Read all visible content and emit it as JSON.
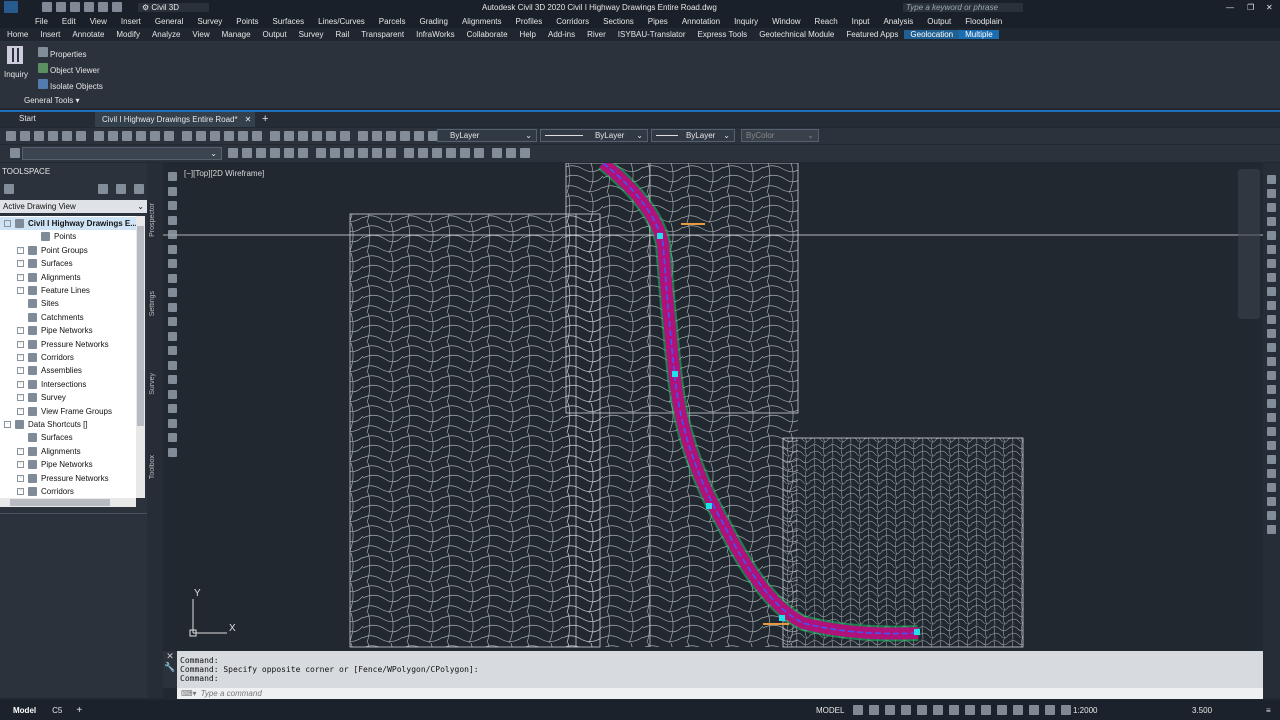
{
  "app": {
    "title": "Autodesk Civil 3D 2020    Civil I Highway Drawings Entire Road.dwg",
    "workspace": "Civil 3D",
    "search_placeholder": "Type a keyword or phrase"
  },
  "menu": [
    "File",
    "Edit",
    "View",
    "Insert",
    "General",
    "Survey",
    "Points",
    "Surfaces",
    "Lines/Curves",
    "Parcels",
    "Grading",
    "Alignments",
    "Profiles",
    "Corridors",
    "Sections",
    "Pipes",
    "Annotation",
    "Inquiry",
    "Window",
    "Reach",
    "Input",
    "Analysis",
    "Output",
    "Floodplain"
  ],
  "ribbon_tabs": [
    "Home",
    "Insert",
    "Annotate",
    "Modify",
    "Analyze",
    "View",
    "Manage",
    "Output",
    "Survey",
    "Rail",
    "Transparent",
    "InfraWorks",
    "Collaborate",
    "Help",
    "Add-ins",
    "River",
    "ISYBAU-Translator",
    "Express Tools",
    "Geotechnical Module",
    "Featured Apps",
    "Geolocation",
    "Multiple"
  ],
  "ribbon": {
    "big_button": "Inquiry",
    "items": [
      "Properties",
      "Object Viewer",
      "Isolate Objects"
    ],
    "panel": "General Tools"
  },
  "doc_tabs": {
    "start": "Start",
    "active": "Civil I Highway Drawings Entire Road*"
  },
  "toolbar": {
    "layer": "ByLayer",
    "linetype": "ByLayer",
    "lineweight": "ByLayer",
    "color": "ByColor"
  },
  "toolspace": {
    "title": "TOOLSPACE",
    "view": "Active Drawing View",
    "tabs": [
      "Prospector",
      "Settings",
      "Survey",
      "Toolbox"
    ],
    "tree": [
      {
        "label": "Civil I Highway Drawings E...",
        "level": 0,
        "exp": "-",
        "bold": true
      },
      {
        "label": "Points",
        "level": 2,
        "exp": ""
      },
      {
        "label": "Point Groups",
        "level": 1,
        "exp": "+"
      },
      {
        "label": "Surfaces",
        "level": 1,
        "exp": "+"
      },
      {
        "label": "Alignments",
        "level": 1,
        "exp": "+"
      },
      {
        "label": "Feature Lines",
        "level": 1,
        "exp": "+"
      },
      {
        "label": "Sites",
        "level": 1,
        "exp": ""
      },
      {
        "label": "Catchments",
        "level": 1,
        "exp": ""
      },
      {
        "label": "Pipe Networks",
        "level": 1,
        "exp": "+"
      },
      {
        "label": "Pressure Networks",
        "level": 1,
        "exp": "+"
      },
      {
        "label": "Corridors",
        "level": 1,
        "exp": "+"
      },
      {
        "label": "Assemblies",
        "level": 1,
        "exp": "+"
      },
      {
        "label": "Intersections",
        "level": 1,
        "exp": "+"
      },
      {
        "label": "Survey",
        "level": 1,
        "exp": "+"
      },
      {
        "label": "View Frame Groups",
        "level": 1,
        "exp": "+"
      },
      {
        "label": "Data Shortcuts []",
        "level": 0,
        "exp": "-"
      },
      {
        "label": "Surfaces",
        "level": 1,
        "exp": ""
      },
      {
        "label": "Alignments",
        "level": 1,
        "exp": "+"
      },
      {
        "label": "Pipe Networks",
        "level": 1,
        "exp": "+"
      },
      {
        "label": "Pressure Networks",
        "level": 1,
        "exp": "+"
      },
      {
        "label": "Corridors",
        "level": 1,
        "exp": "+"
      }
    ]
  },
  "viewport": {
    "label": "[−][Top][2D Wireframe]",
    "ucs_x": "X",
    "ucs_y": "Y"
  },
  "command": {
    "lines": [
      "Command:",
      "Command: Specify opposite corner or [Fence/WPolygon/CPolygon]:",
      "Command:"
    ],
    "placeholder": "Type a command"
  },
  "status": {
    "tabs": [
      "Model",
      "C5"
    ],
    "mode": "MODEL",
    "scale": "1:2000",
    "value": "3.500"
  },
  "colors": {
    "road": "#b0127a",
    "centerline": "#3c58ff",
    "grip": "#21e0e8",
    "contour": "#c8c8c8",
    "accent": "#1b6db2"
  }
}
